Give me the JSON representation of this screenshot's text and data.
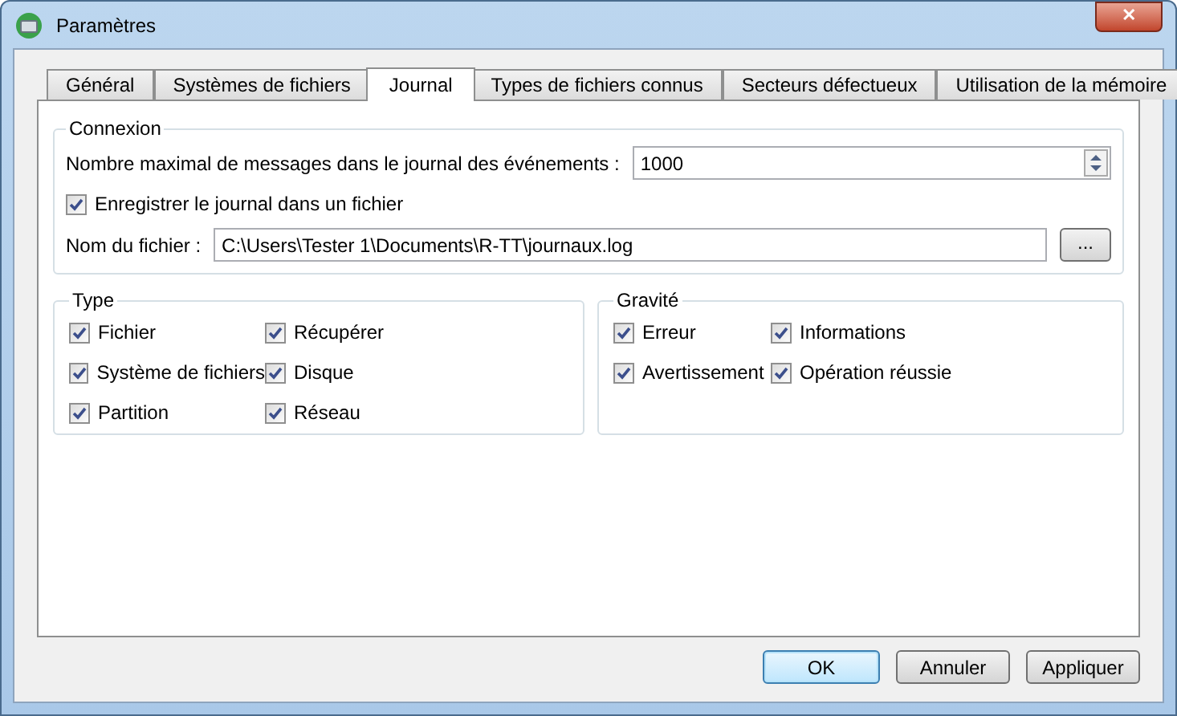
{
  "window": {
    "title": "Paramètres",
    "close": "✕"
  },
  "tabs": [
    {
      "label": "Général",
      "selected": false
    },
    {
      "label": "Systèmes de fichiers",
      "selected": false
    },
    {
      "label": "Journal",
      "selected": true
    },
    {
      "label": "Types de fichiers connus",
      "selected": false
    },
    {
      "label": "Secteurs défectueux",
      "selected": false
    },
    {
      "label": "Utilisation de la mémoire",
      "selected": false
    }
  ],
  "connexion": {
    "title": "Connexion",
    "max_label": "Nombre maximal de messages dans le journal des événements :",
    "max_value": "1000",
    "save_to_file": {
      "label": "Enregistrer le journal dans un fichier",
      "checked": true
    },
    "file_label": "Nom du fichier :",
    "file_value": "C:\\Users\\Tester 1\\Documents\\R-TT\\journaux.log",
    "browse": "..."
  },
  "type": {
    "title": "Type",
    "items": [
      {
        "label": "Fichier",
        "checked": true
      },
      {
        "label": "Système de fichiers",
        "checked": true
      },
      {
        "label": "Partition",
        "checked": true
      },
      {
        "label": "Récupérer",
        "checked": true
      },
      {
        "label": "Disque",
        "checked": true
      },
      {
        "label": "Réseau",
        "checked": true
      }
    ]
  },
  "gravite": {
    "title": "Gravité",
    "items": [
      {
        "label": "Erreur",
        "checked": true
      },
      {
        "label": "Avertissement",
        "checked": true
      },
      {
        "label": "Informations",
        "checked": true
      },
      {
        "label": "Opération réussie",
        "checked": true
      }
    ]
  },
  "buttons": [
    {
      "label": "OK",
      "default": true
    },
    {
      "label": "Annuler",
      "default": false
    },
    {
      "label": "Appliquer",
      "default": false
    }
  ]
}
